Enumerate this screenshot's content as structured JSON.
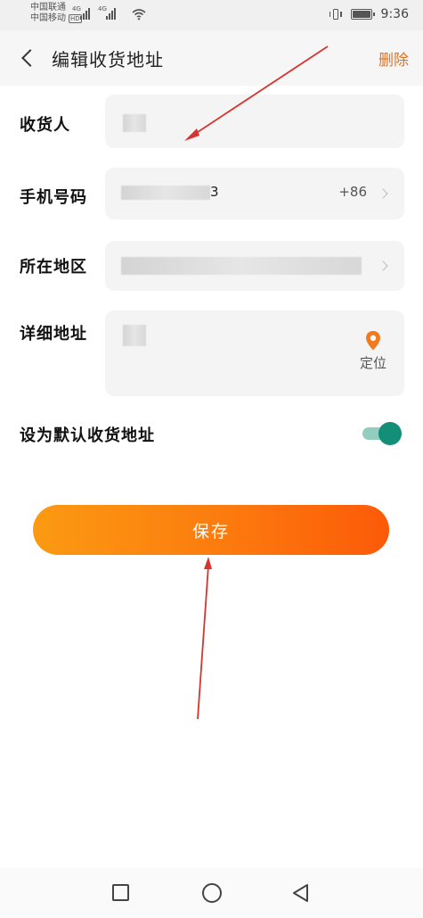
{
  "status_bar": {
    "carrier_1": "中国联通",
    "carrier_2": "中国移动",
    "hd_badge": "HD",
    "network_1": "4G",
    "network_2": "4G",
    "time": "9:36"
  },
  "header": {
    "title": "编辑收货地址",
    "delete_label": "删除"
  },
  "form": {
    "recipient_label": "收货人",
    "phone_label": "手机号码",
    "phone_visible_suffix": "3",
    "country_code": "+86",
    "region_label": "所在地区",
    "address_label": "详细地址",
    "locate_label": "定位",
    "default_label": "设为默认收货地址",
    "default_enabled": true
  },
  "save_label": "保存",
  "colors": {
    "accent": "#e8711a",
    "button_start": "#fb9a12",
    "button_end": "#fc5a08",
    "toggle": "#138f78",
    "annotation": "#d8342f"
  }
}
